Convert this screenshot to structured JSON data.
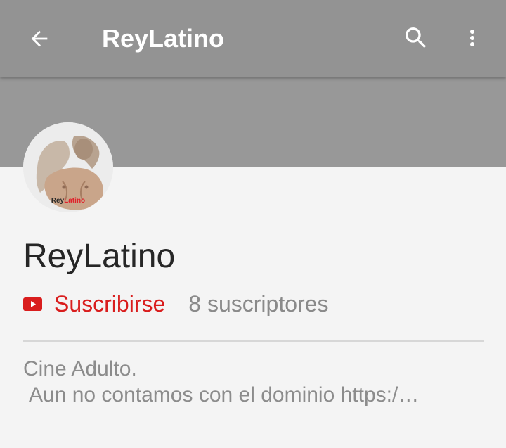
{
  "appbar": {
    "title": "ReyLatino",
    "back_icon": "arrow-back-icon",
    "search_icon": "search-icon",
    "more_icon": "more-vert-icon"
  },
  "channel": {
    "name": "ReyLatino",
    "avatar_watermark_part1": "Rey",
    "avatar_watermark_part2": "Latino",
    "subscribe_label": "Suscribirse",
    "subscriber_count": "8 suscriptores",
    "description_line1": "Cine Adulto.",
    "description_line2": "Aun no contamos con el dominio https:/…"
  },
  "colors": {
    "appbar": "#939393",
    "banner": "#989898",
    "background": "#f4f4f4",
    "accent": "#d91d1d",
    "secondary_text": "#8a8a8a"
  }
}
